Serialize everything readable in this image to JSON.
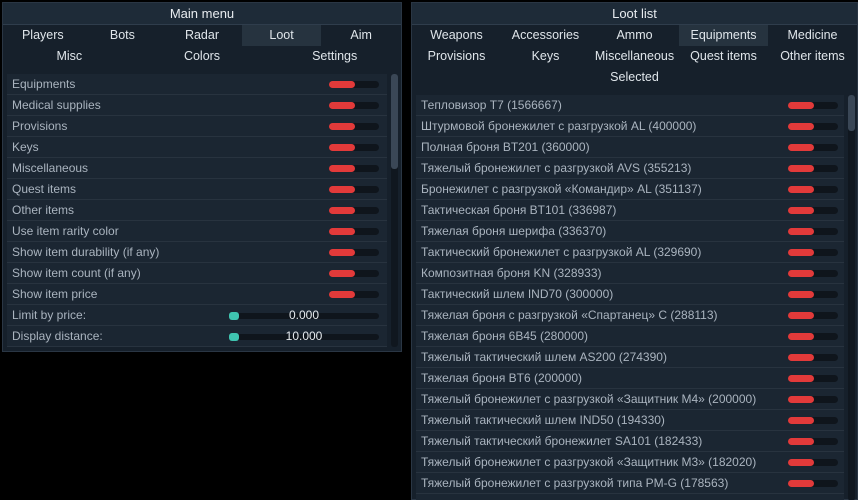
{
  "main_menu": {
    "title": "Main menu",
    "tabs_row1": [
      "Players",
      "Bots",
      "Radar",
      "Loot",
      "Aim"
    ],
    "tabs_row2": [
      "Misc",
      "Colors",
      "Settings"
    ],
    "active_tab": "Loot",
    "toggles": [
      {
        "label": "Equipments",
        "on": true
      },
      {
        "label": "Medical supplies",
        "on": true
      },
      {
        "label": "Provisions",
        "on": true
      },
      {
        "label": "Keys",
        "on": true
      },
      {
        "label": "Miscellaneous",
        "on": true
      },
      {
        "label": "Quest items",
        "on": true
      },
      {
        "label": "Other items",
        "on": true
      },
      {
        "label": "Use item rarity color",
        "on": true
      },
      {
        "label": "Show item durability (if any)",
        "on": true
      },
      {
        "label": "Show item count (if any)",
        "on": true
      },
      {
        "label": "Show item price",
        "on": true
      }
    ],
    "sliders": [
      {
        "label": "Limit by price:",
        "value": "0.000",
        "fraction": 0.0
      },
      {
        "label": "Display distance:",
        "value": "10.000",
        "fraction": 0.0
      }
    ],
    "colors": {
      "toggle_accent": "#e23a3a",
      "slider_accent": "#3fc4b0"
    }
  },
  "loot_list": {
    "title": "Loot list",
    "tabs_row1": [
      "Weapons",
      "Accessories",
      "Ammo",
      "Equipments",
      "Medicine"
    ],
    "tabs_row2": [
      "Provisions",
      "Keys",
      "Miscellaneous",
      "Quest items",
      "Other items"
    ],
    "tabs_row3": [
      "Selected"
    ],
    "active_tab": "Equipments",
    "items": [
      "Тепловизор T7 (1566667)",
      "Штурмовой бронежилет с разгрузкой AL (400000)",
      "Полная броня BT201 (360000)",
      "Тяжелый бронежилет с разгрузкой AVS (355213)",
      "Бронежилет с разгрузкой «Командир» AL (351137)",
      "Тактическая броня BT101 (336987)",
      "Тяжелая броня шерифа (336370)",
      "Тактический бронежилет с разгрузкой AL (329690)",
      "Композитная броня KN (328933)",
      "Тактический шлем IND70 (300000)",
      "Тяжелая броня с разгрузкой «Спартанец» С (288113)",
      "Тяжелая броня 6B45 (280000)",
      "Тяжелый тактический шлем AS200 (274390)",
      "Тяжелая броня BT6 (200000)",
      "Тяжелый бронежилет с разгрузкой «Защитник M4» (200000)",
      "Тяжелый тактический шлем IND50 (194330)",
      "Тяжелый тактический бронежилет SA101 (182433)",
      "Тяжелый бронежилет с разгрузкой «Защитник M3» (182020)",
      "Тяжелый бронежилет с разгрузкой типа PM-G (178563)"
    ]
  }
}
